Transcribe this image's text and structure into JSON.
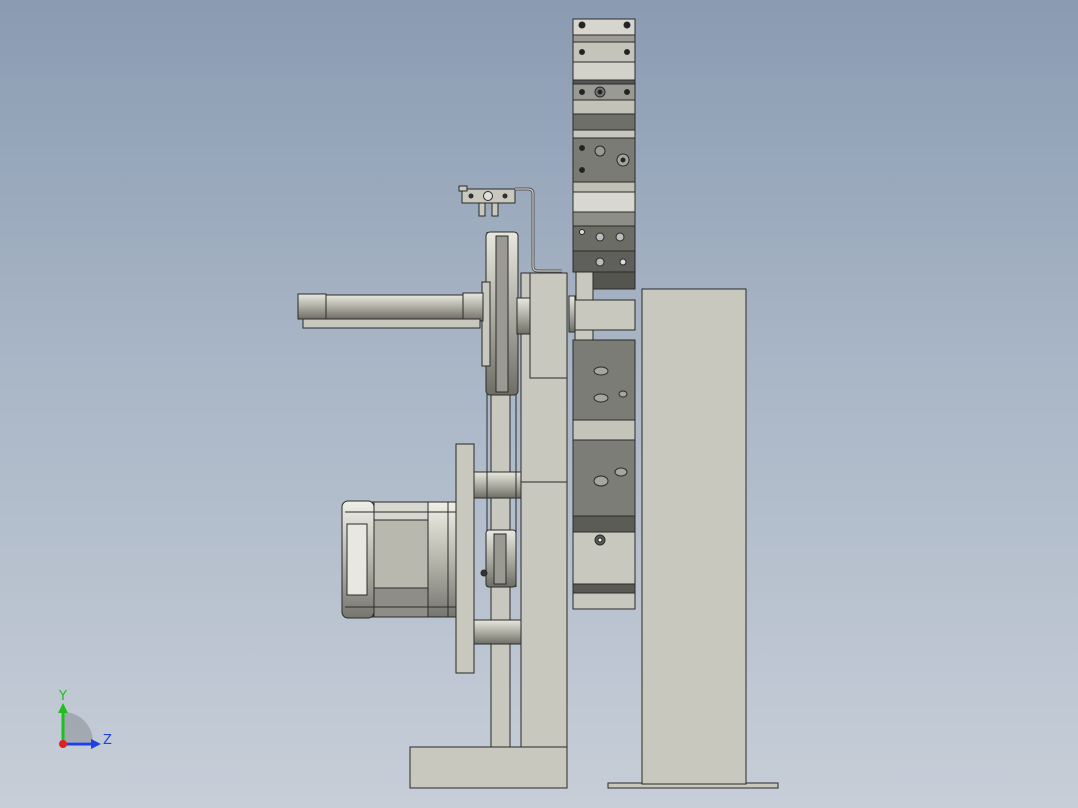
{
  "view": {
    "background_top": "#8a9bb2",
    "background_bottom": "#c7ced8",
    "part_fill": "#c8c8be",
    "part_stroke": "#2a2a2a",
    "dark_fill": "#6b6b66"
  },
  "triad": {
    "y_label": "Y",
    "z_label": "Z",
    "y_color": "#1fbf1f",
    "z_color": "#2040e0",
    "x_color": "#e02020"
  }
}
